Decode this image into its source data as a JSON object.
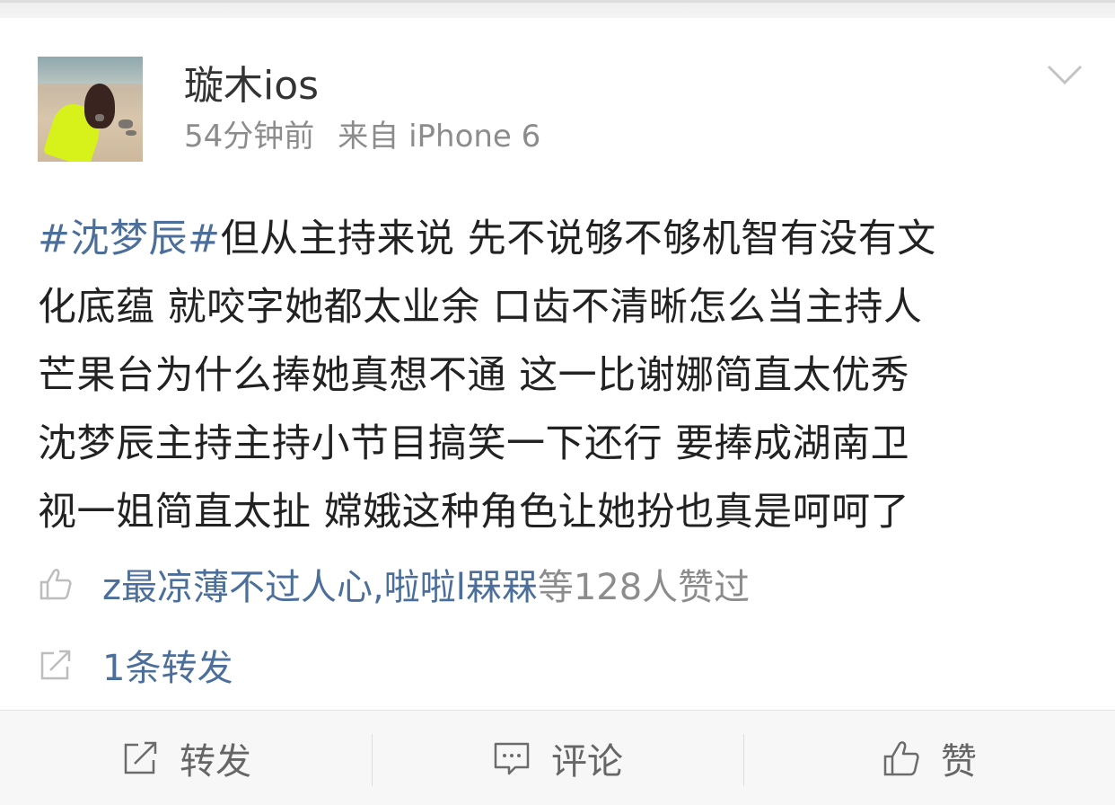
{
  "post": {
    "username": "璇木ios",
    "time": "54分钟前",
    "source": "来自 iPhone 6",
    "hashtag": "#沈梦辰#",
    "text_lines": [
      "但从主持来说 先不说够不够机智有没有文",
      "化底蕴 就咬字她都太业余 口齿不清晰怎么当主持人",
      "芒果台为什么捧她真想不通 这一比谢娜简直太优秀",
      "沈梦辰主持主持小节目搞笑一下还行 要捧成湖南卫",
      "视一姐简直太扯 嫦娥这种角色让她扮也真是呵呵了"
    ]
  },
  "likes": {
    "users": "z最凉薄不过人心,啦啦l槑槑",
    "suffix": "等128人赞过"
  },
  "reposts": {
    "text": "1条转发"
  },
  "action_bar": {
    "repost_label": "转发",
    "comment_label": "评论",
    "like_label": "赞"
  },
  "colors": {
    "link_blue": "#4c6e9a",
    "meta_gray": "#8c8c8c",
    "text_dark": "#222222"
  },
  "icons": {
    "menu": "chevron-down-icon",
    "likes": "thumbs-up-icon",
    "reposts": "share-icon",
    "repost_action": "repost-icon",
    "comment_action": "comment-icon",
    "like_action": "thumbs-up-icon"
  }
}
